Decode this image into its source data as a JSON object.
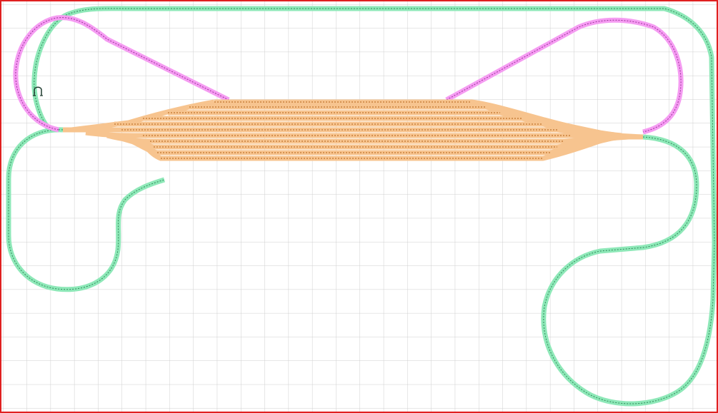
{
  "layout": {
    "border_color": "#e02020",
    "grid_color": "#cccccc",
    "background": "#ffffff"
  },
  "colors": {
    "main_line": "#8ee8b8",
    "main_line_rail": "#2e8a58",
    "connector": "#f59cf2",
    "connector_rail": "#9b2e99",
    "yard": "#f7c48f",
    "yard_rail": "#b35f13"
  },
  "tracks": {
    "outer_loop": "main-line",
    "left_return": "main-line",
    "right_return": "main-line",
    "left_connector": "connector",
    "right_connector": "connector",
    "yard_tracks": "yard"
  },
  "yard": {
    "track_count": 11
  },
  "icons": {
    "bumper": "track-end-icon"
  }
}
